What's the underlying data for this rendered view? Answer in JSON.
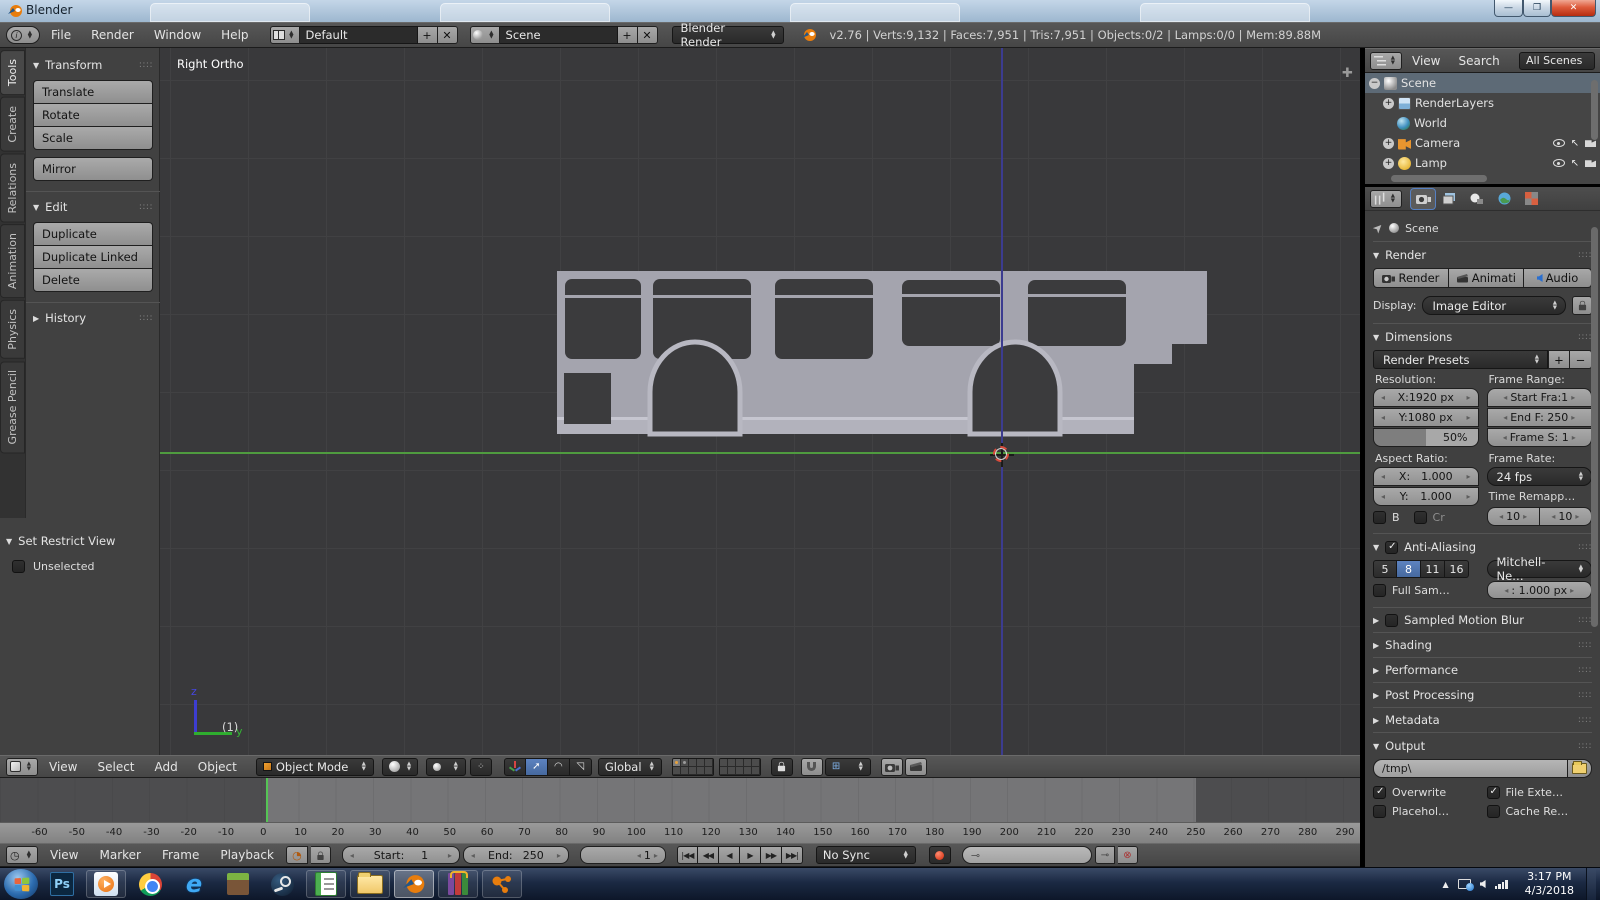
{
  "icons_note": "icon glyphs rendered via CSS; semantic names on data-name",
  "window": {
    "title": "Blender"
  },
  "menubar": {
    "menus": [
      "File",
      "Render",
      "Window",
      "Help"
    ],
    "layout": "Default",
    "scene": "Scene",
    "engine": "Blender Render",
    "stats": "v2.76 | Verts:9,132 | Faces:7,951 | Tris:7,951 | Objects:0/2 | Lamps:0/0 | Mem:89.88M"
  },
  "tool_shelf": {
    "tabs": [
      "Tools",
      "Create",
      "Relations",
      "Animation",
      "Physics",
      "Grease Pencil"
    ],
    "transform": {
      "title": "Transform",
      "translate": "Translate",
      "rotate": "Rotate",
      "scale": "Scale",
      "mirror": "Mirror"
    },
    "edit": {
      "title": "Edit",
      "duplicate": "Duplicate",
      "duplicate_linked": "Duplicate Linked",
      "delete": "Delete"
    },
    "history": {
      "title": "History"
    },
    "redo": {
      "title": "Set Restrict View",
      "option": "Unselected"
    }
  },
  "viewport": {
    "view_label": "Right Ortho",
    "object_info": "(1)",
    "axis_y": "y",
    "axis_z": "z",
    "header": {
      "menus": [
        "View",
        "Select",
        "Add",
        "Object"
      ],
      "mode": "Object Mode",
      "orientation": "Global"
    }
  },
  "timeline": {
    "menus": [
      "View",
      "Marker",
      "Frame",
      "Playback"
    ],
    "ruler": [
      "-60",
      "-50",
      "-40",
      "-30",
      "-20",
      "-10",
      "0",
      "10",
      "20",
      "30",
      "40",
      "50",
      "60",
      "70",
      "80",
      "90",
      "100",
      "110",
      "120",
      "130",
      "140",
      "150",
      "160",
      "170",
      "180",
      "190",
      "200",
      "210",
      "220",
      "230",
      "240",
      "250",
      "260",
      "270",
      "280",
      "290"
    ],
    "start_label": "Start:",
    "start_value": "1",
    "end_label": "End:",
    "end_value": "250",
    "current_frame": "1",
    "sync": "No Sync"
  },
  "outliner": {
    "menus": [
      "View",
      "Search"
    ],
    "scope": "All Scenes",
    "rows": [
      {
        "label": "Scene"
      },
      {
        "label": "RenderLayers"
      },
      {
        "label": "World"
      },
      {
        "label": "Camera"
      },
      {
        "label": "Lamp"
      }
    ]
  },
  "properties": {
    "context": "Scene",
    "render": {
      "title": "Render",
      "render_btn": "Render",
      "anim_btn": "Animati",
      "audio_btn": "Audio",
      "display_label": "Display:",
      "display_value": "Image Editor"
    },
    "dimensions": {
      "title": "Dimensions",
      "presets": "Render Presets",
      "resolution_label": "Resolution:",
      "res_x": "X:1920 px",
      "res_y": "Y:1080 px",
      "res_pct": "50%",
      "frame_range_label": "Frame Range:",
      "fr_start": "Start Fra:1",
      "fr_end": "End F: 250",
      "fr_step": "Frame S: 1",
      "aspect_label": "Aspect Ratio:",
      "aspect_x_label": "X:",
      "aspect_x_val": "1.000",
      "aspect_y_label": "Y:",
      "aspect_y_val": "1.000",
      "frame_rate_label": "Frame Rate:",
      "fps": "24 fps",
      "time_remap_label": "Time Remapp…",
      "remap_a": "10",
      "remap_b": "10",
      "border_label": "B",
      "crop_label": "Cr"
    },
    "aa": {
      "title": "Anti-Aliasing",
      "samples": [
        "5",
        "8",
        "11",
        "16"
      ],
      "filter": "Mitchell-Ne…",
      "full_sample": "Full Sam…",
      "size": ": 1.000 px"
    },
    "collapsed": [
      "Sampled Motion Blur",
      "Shading",
      "Performance",
      "Post Processing",
      "Metadata"
    ],
    "output": {
      "title": "Output",
      "path": "/tmp\\",
      "overwrite": "Overwrite",
      "file_ext": "File Exte…",
      "placeholder": "Placehol…",
      "cache": "Cache Re…"
    }
  },
  "taskbar": {
    "tray_time": "3:17 PM",
    "tray_date": "4/3/2018"
  }
}
